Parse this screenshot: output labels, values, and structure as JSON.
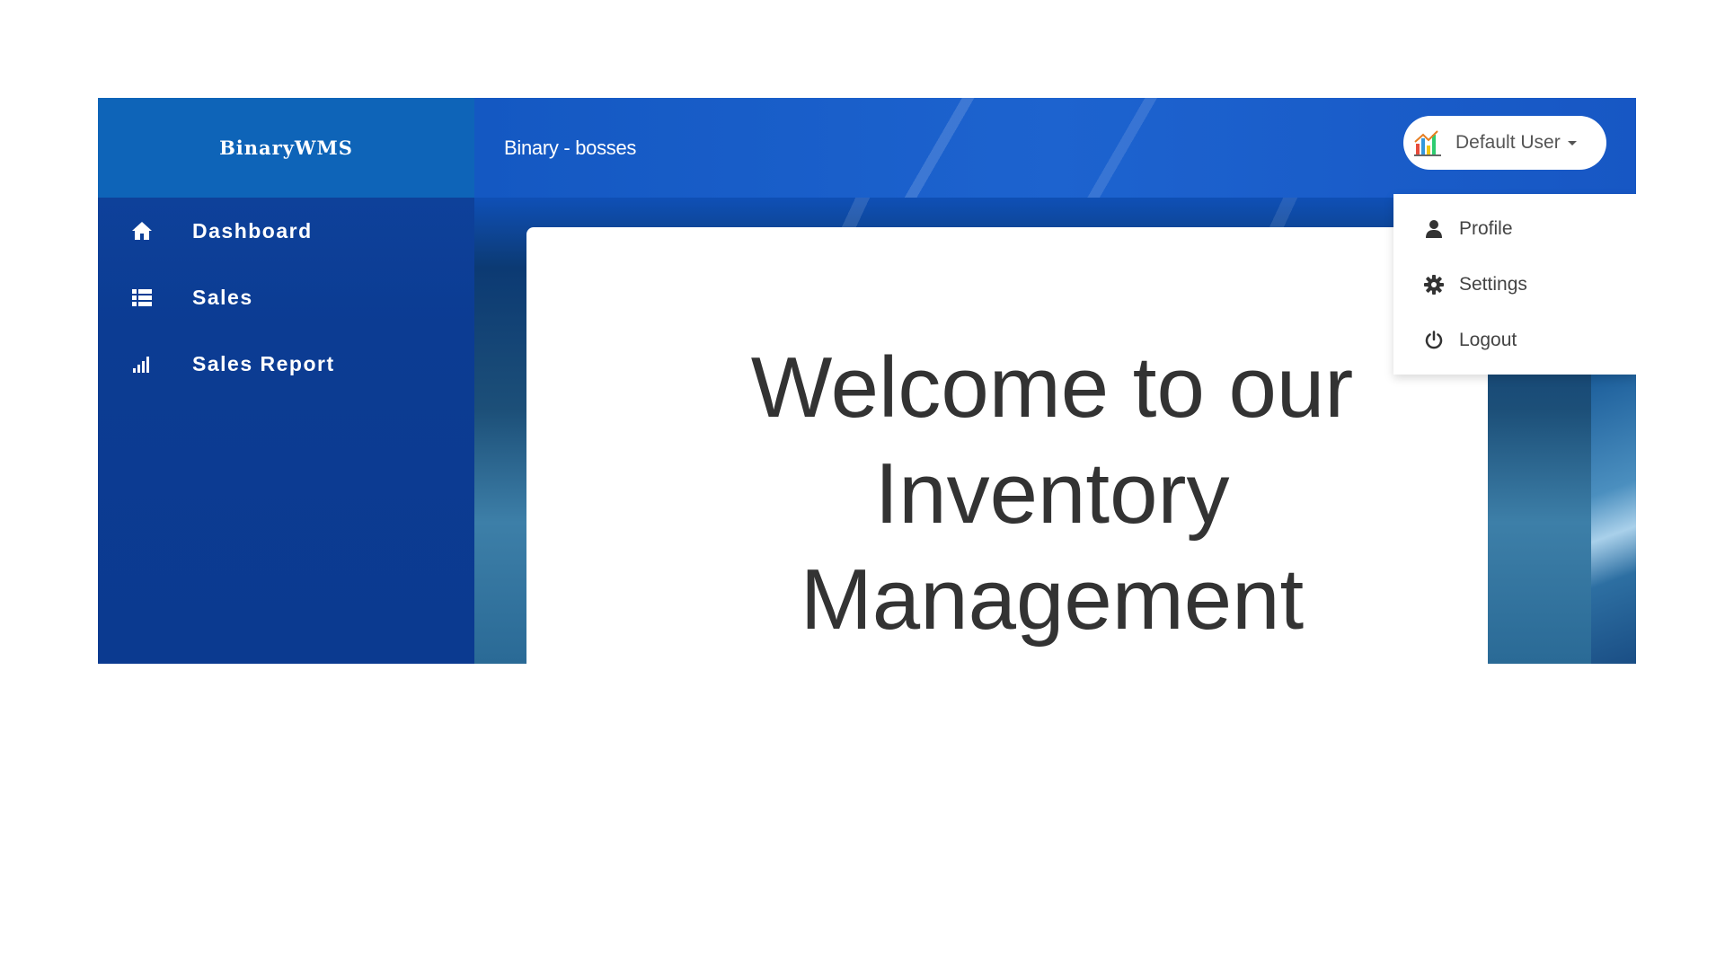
{
  "brand": {
    "name": "BinaryWMS"
  },
  "sidebar": {
    "items": [
      {
        "label": "Dashboard",
        "icon": "home-icon"
      },
      {
        "label": "Sales",
        "icon": "list-icon"
      },
      {
        "label": "Sales Report",
        "icon": "bar-chart-icon"
      }
    ]
  },
  "topbar": {
    "title": "Binary - bosses",
    "user": {
      "name": "Default User",
      "avatar_icon": "chart-avatar-icon"
    }
  },
  "dropdown": {
    "items": [
      {
        "label": "Profile",
        "icon": "user-icon"
      },
      {
        "label": "Settings",
        "icon": "gear-icon"
      },
      {
        "label": "Logout",
        "icon": "power-icon"
      }
    ]
  },
  "main": {
    "welcome_text": "Welcome to our\nInventory\nManagement"
  },
  "colors": {
    "sidebar": "#0d3f97",
    "brand_bg": "#0e64b8",
    "topbar": "#1d63cf",
    "text_dark": "#333333"
  }
}
